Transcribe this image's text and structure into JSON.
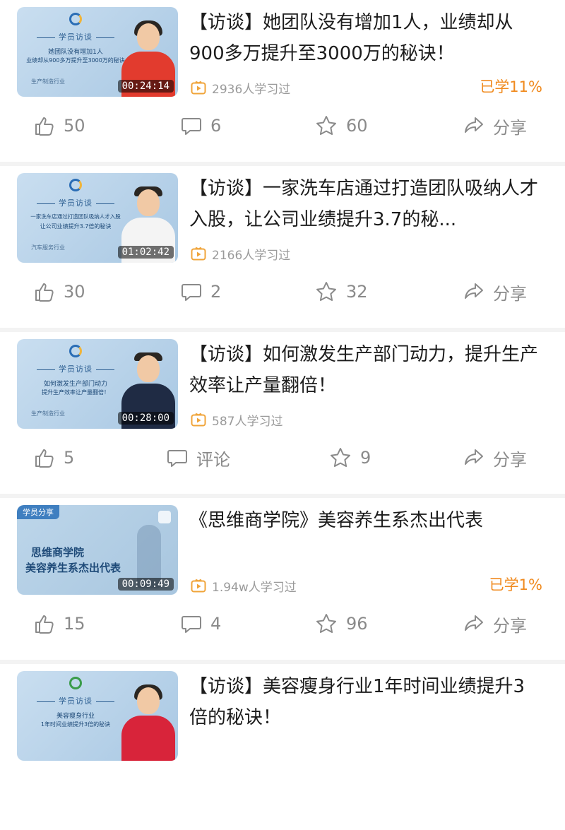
{
  "colors": {
    "accent_orange": "#f08a1e",
    "muted_gray": "#8a8a8a",
    "title_dark": "#1c1c1c"
  },
  "icons": {
    "like": "thumbs-up-icon",
    "comment": "comment-icon",
    "favorite": "star-icon",
    "share": "share-icon",
    "learners": "play-video-icon"
  },
  "posts": [
    {
      "title": "【访谈】她团队没有增加1人，业绩却从900多万提升至3000万的秘诀！",
      "duration": "00:24:14",
      "learners": "2936人学习过",
      "progress": "已学11%",
      "likes": "50",
      "comments": "6",
      "favorites": "60",
      "share": "分享",
      "thumb": {
        "banner": "学员访谈",
        "line1": "她团队没有增加1人",
        "line2": "业绩却从900多万提升至3000万的秘诀",
        "industry": "生产制造行业"
      }
    },
    {
      "title": "【访谈】一家洗车店通过打造团队吸纳人才入股，让公司业绩提升3.7的秘...",
      "duration": "01:02:42",
      "learners": "2166人学习过",
      "progress": "",
      "likes": "30",
      "comments": "2",
      "favorites": "32",
      "share": "分享",
      "thumb": {
        "banner": "学员访谈",
        "line1": "一家洗车店通过打造团队吸纳人才入股",
        "line2": "让公司业绩提升3.7倍的秘诀",
        "industry": "汽车服务行业"
      }
    },
    {
      "title": "【访谈】如何激发生产部门动力，提升生产效率让产量翻倍！",
      "duration": "00:28:00",
      "learners": "587人学习过",
      "progress": "",
      "likes": "5",
      "comments": "评论",
      "favorites": "9",
      "share": "分享",
      "thumb": {
        "banner": "学员访谈",
        "line1": "如何激发生产部门动力",
        "line2": "提升生产效率让产量翻倍！",
        "industry": "生产制造行业"
      }
    },
    {
      "title": "《思维商学院》美容养生系杰出代表",
      "duration": "00:09:49",
      "learners": "1.94w人学习过",
      "progress": "已学1%",
      "likes": "15",
      "comments": "4",
      "favorites": "96",
      "share": "分享",
      "thumb": {
        "tag": "学员分享",
        "line1": "思维商学院",
        "line2": "美容养生系杰出代表"
      }
    },
    {
      "title": "【访谈】美容瘦身行业1年时间业绩提升3倍的秘诀！",
      "duration": "",
      "learners": "",
      "progress": "",
      "likes": "",
      "comments": "",
      "favorites": "",
      "share": "",
      "thumb": {
        "banner": "学员访谈",
        "line1": "美容瘦身行业",
        "line2": "1年时间业绩提升3倍的秘诀",
        "industry": ""
      }
    }
  ]
}
